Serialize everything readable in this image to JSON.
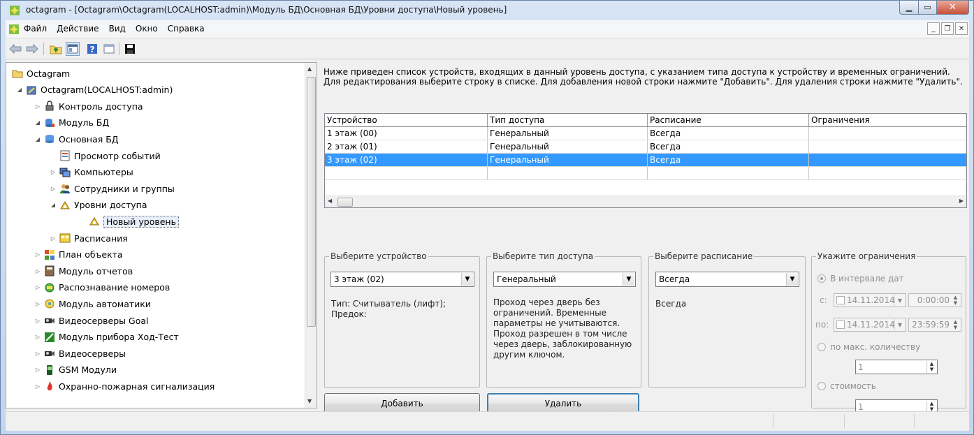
{
  "window": {
    "title": "octagram - [Octagram\\Octagram(LOCALHOST:admin)\\Модуль БД\\Основная БД\\Уровни доступа\\Новый уровень]"
  },
  "menu": {
    "items": [
      "Файл",
      "Действие",
      "Вид",
      "Окно",
      "Справка"
    ]
  },
  "tree": {
    "items": [
      {
        "label": "Octagram",
        "level": 0,
        "arrow": "",
        "icon": "folder-icon"
      },
      {
        "label": "Octagram(LOCALHOST:admin)",
        "level": 1,
        "arrow": "◢",
        "icon": "server-icon"
      },
      {
        "label": "Контроль доступа",
        "level": 2,
        "arrow": "▷",
        "icon": "lock-icon"
      },
      {
        "label": "Модуль БД",
        "level": 2,
        "arrow": "◢",
        "icon": "database-module-icon"
      },
      {
        "label": "Основная БД",
        "level": 3,
        "arrow": "◢",
        "icon": "database-icon"
      },
      {
        "label": "Просмотр событий",
        "level": 4,
        "arrow": "",
        "icon": "events-icon"
      },
      {
        "label": "Компьютеры",
        "level": 4,
        "arrow": "▷",
        "icon": "computers-icon"
      },
      {
        "label": "Сотрудники и группы",
        "level": 4,
        "arrow": "▷",
        "icon": "users-icon"
      },
      {
        "label": "Уровни доступа",
        "level": 4,
        "arrow": "◢",
        "icon": "access-levels-icon"
      },
      {
        "label": "Новый уровень",
        "level": 5,
        "arrow": "",
        "icon": "access-level-icon",
        "selected": true
      },
      {
        "label": "Расписания",
        "level": 4,
        "arrow": "▷",
        "icon": "schedule-icon"
      },
      {
        "label": "План объекта",
        "level": 2,
        "arrow": "▷",
        "icon": "plan-icon"
      },
      {
        "label": "Модуль отчетов",
        "level": 2,
        "arrow": "▷",
        "icon": "reports-icon"
      },
      {
        "label": "Распознавание номеров",
        "level": 2,
        "arrow": "▷",
        "icon": "plates-icon"
      },
      {
        "label": "Модуль автоматики",
        "level": 2,
        "arrow": "▷",
        "icon": "automation-icon"
      },
      {
        "label": "Видеосерверы Goal",
        "level": 2,
        "arrow": "▷",
        "icon": "camera-icon"
      },
      {
        "label": "Модуль прибора Ход-Тест",
        "level": 2,
        "arrow": "▷",
        "icon": "device-icon"
      },
      {
        "label": "Видеосерверы",
        "level": 2,
        "arrow": "▷",
        "icon": "camera-icon"
      },
      {
        "label": "GSM Модули",
        "level": 2,
        "arrow": "▷",
        "icon": "gsm-icon"
      },
      {
        "label": "Охранно-пожарная сигнализация",
        "level": 2,
        "arrow": "▷",
        "icon": "fire-alarm-icon"
      }
    ]
  },
  "main": {
    "description": "Ниже приведен список устройств, входящих в данный уровень доступа, с указанием типа доступа к устройству и временных ограничений. Для редактирования выберите строку в списке. Для добавления новой строки нажмите \"Добавить\". Для удаления строки нажмите \"Удалить\".",
    "table": {
      "columns": [
        "Устройство",
        "Тип доступа",
        "Расписание",
        "Ограничения"
      ],
      "rows": [
        [
          "1 этаж (00)",
          "Генеральный",
          "Всегда",
          ""
        ],
        [
          "2 этаж (01)",
          "Генеральный",
          "Всегда",
          ""
        ],
        [
          "3 этаж (02)",
          "Генеральный",
          "Всегда",
          ""
        ]
      ],
      "selected_row": 2
    },
    "device_group": {
      "title": "Выберите устройство",
      "value": "3 этаж (02)",
      "info": "Тип: Считыватель (лифт);\nПредок:"
    },
    "access_group": {
      "title": "Выберите тип доступа",
      "value": "Генеральный",
      "info": "Проход через дверь без ограничений. Временные параметры не учитываются. Проход разрешен в том числе через дверь, заблокированную другим ключом."
    },
    "schedule_group": {
      "title": "Выберите расписание",
      "value": "Всегда",
      "info": "Всегда"
    },
    "limits_group": {
      "title": "Укажите ограничения",
      "radio_dates": "В интервале дат",
      "from_label": "с:",
      "from_date": "14.11.2014",
      "from_time": "0:00:00",
      "to_label": "по:",
      "to_date": "14.11.2014",
      "to_time": "23:59:59",
      "radio_count": "по макс. количеству",
      "count_value": "1",
      "radio_cost": "стоимость",
      "cost_value": "1"
    },
    "add_button": "Добавить",
    "delete_button": "Удалить"
  }
}
